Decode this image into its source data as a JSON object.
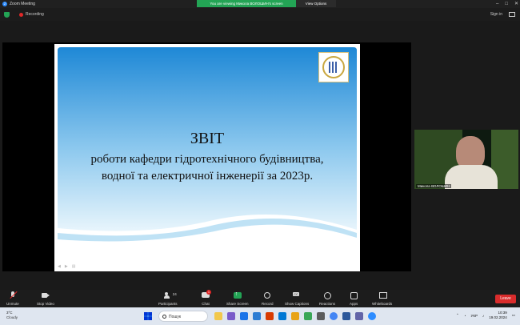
{
  "window": {
    "title": "Zoom Meeting"
  },
  "share_banner": {
    "message": "You are viewing Микола ВОЛОШИН's screen",
    "options_label": "View Options"
  },
  "topbar": {
    "recording_label": "Recording",
    "sign_in": "Sign in"
  },
  "slide": {
    "title": "ЗВІТ",
    "line1": "роботи кафедри гідротехнічного будівництва,",
    "line2": "водної та електричної інженерії за 2023р."
  },
  "participant_video": {
    "name": "Микола ВОЛОШИН"
  },
  "controls": {
    "unmute": "Unmute",
    "stop_video": "Stop Video",
    "participants": "Participants",
    "participants_count": "24",
    "chat": "Chat",
    "chat_badge": "1",
    "share_screen": "Share Screen",
    "record": "Record",
    "show_captions": "Show Captions",
    "reactions": "Reactions",
    "apps": "Apps",
    "whiteboards": "Whiteboards",
    "leave": "Leave"
  },
  "taskbar": {
    "weather_temp": "3°C",
    "weather_cond": "Cloudy",
    "search_placeholder": "Пошук",
    "lang": "УКР",
    "time": "10:39",
    "date": "19.02.2024"
  },
  "colors": {
    "zoom_green": "#23a455",
    "leave_red": "#d92c2c",
    "slide_blue": "#1e88d6"
  }
}
